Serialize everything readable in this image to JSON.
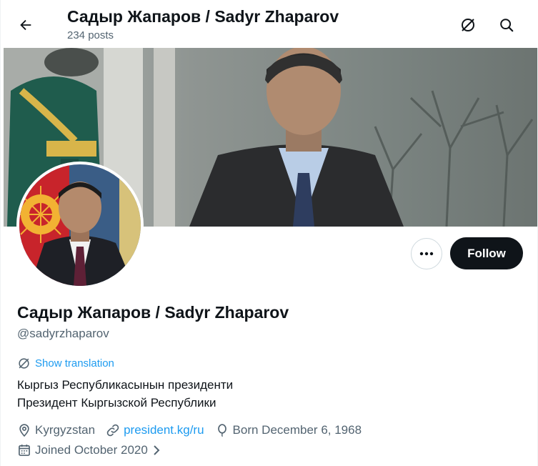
{
  "header": {
    "title": "Садыр Жапаров / Sadyr Zhaparov",
    "posts_count": "234 posts"
  },
  "profile": {
    "display_name": "Садыр Жапаров / Sadyr Zhaparov",
    "handle": "@sadyrzhaparov",
    "show_translation_label": "Show translation",
    "bio_line1": "Кыргыз Республикасынын президенти",
    "bio_line2": "Президент Кыргызской Республики",
    "location": "Kyrgyzstan",
    "website": "president.kg/ru",
    "born": "Born December 6, 1968",
    "joined": "Joined October 2020"
  },
  "actions": {
    "follow_label": "Follow"
  },
  "icons": {
    "back": "arrow-left-icon",
    "translate": "translate-icon",
    "search": "search-icon",
    "more": "more-dots-icon",
    "location": "location-pin-icon",
    "link": "link-icon",
    "birthday": "balloon-icon",
    "calendar": "calendar-icon",
    "chevron": "chevron-right-icon"
  },
  "colors": {
    "text": "#0f1419",
    "secondary": "#536471",
    "accent": "#1d9bf0",
    "follow_bg": "#0f1419",
    "border": "#cfd9de"
  }
}
